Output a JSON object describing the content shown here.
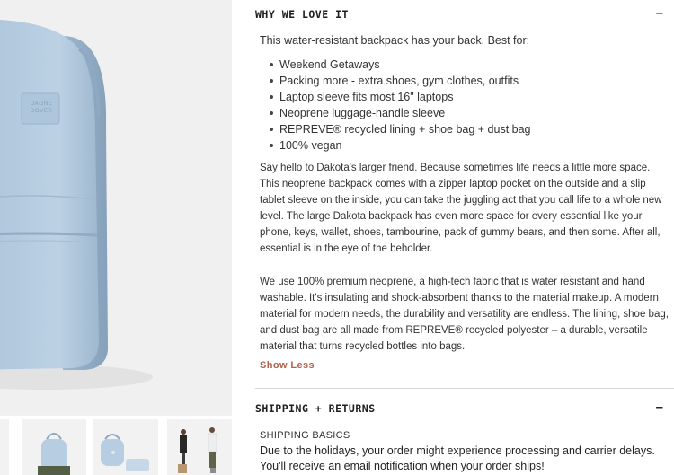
{
  "gallery": {
    "brand_mark": "DAGNE DOVER",
    "thumbnails": [
      "backpack-alt-view",
      "backpack-with-pouch",
      "backpack-accessories",
      "models-wearing-backpack"
    ]
  },
  "description_section": {
    "title": "WHY WE LOVE IT",
    "toggle": "–",
    "intro": "This water-resistant backpack has your back. Best for:",
    "features": [
      "Weekend Getaways",
      "Packing more - extra shoes, gym clothes, outfits",
      "Laptop sleeve fits most 16\" laptops",
      "Neoprene luggage-handle sleeve",
      "REPREVE® recycled lining + shoe bag + dust bag",
      "100% vegan"
    ],
    "paragraph_1": "Say hello to Dakota's larger friend. Because sometimes life needs a little more space. This neoprene backpack comes with a zipper laptop pocket on the outside and a slip tablet sleeve on the inside, you can take the juggling act that you call life to a whole new level. The large Dakota backpack has even more space for every essential like your phone, keys, wallet, shoes, tambourine, pack of gummy bears, and then some. After all, essential is in the eye of the beholder.",
    "paragraph_2": "We use 100% premium neoprene, a high-tech fabric that is water resistant and hand washable. It's insulating and shock-absorbent thanks to the material makeup. A modern material for modern needs, the durability and versatility are endless. The lining, shoe bag, and dust bag are all made from REPREVE® recycled polyester – a durable, versatile material that turns recycled bottles into bags.",
    "show_less": "Show Less"
  },
  "shipping_section": {
    "title": "SHIPPING + RETURNS",
    "toggle": "–",
    "subtitle": "SHIPPING BASICS",
    "text": "Due to the holidays, your order might experience processing and carrier delays. You'll receive an email notification when your order ships!"
  },
  "colors": {
    "backpack": "#b9cfe3",
    "accent_link": "#b0624b",
    "divider": "#d8d8d8"
  }
}
